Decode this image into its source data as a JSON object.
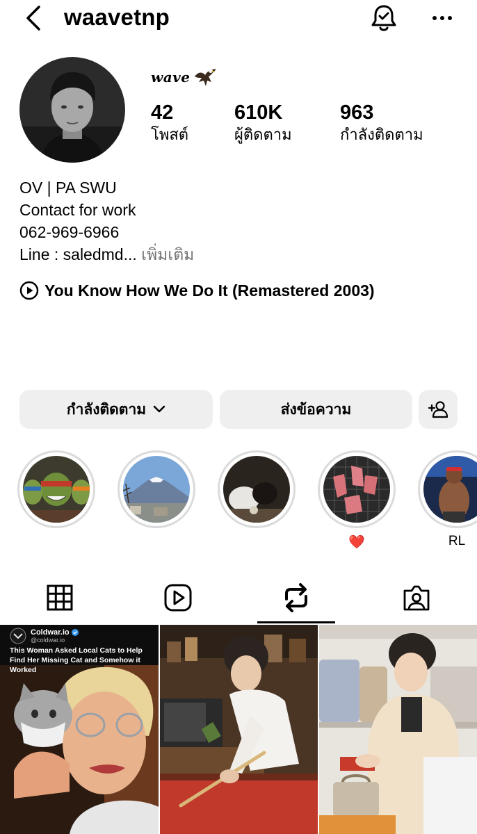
{
  "header": {
    "username": "waavetnp",
    "icons": {
      "back": "chevron-left-icon",
      "notifications": "bell-check-icon",
      "more": "more-horizontal-icon"
    }
  },
  "profile": {
    "display_name": "wave",
    "display_name_emoji": "eagle",
    "stats": [
      {
        "value": "42",
        "label": "โพสต์"
      },
      {
        "value": "610K",
        "label": "ผู้ติดตาม"
      },
      {
        "value": "963",
        "label": "กำลังติดตาม"
      }
    ],
    "bio_lines": [
      "OV | PA SWU",
      "Contact for work",
      "062-969-6966",
      "Line : saledmd..."
    ],
    "bio_more": " เพิ่มเติม",
    "music": "You Know How We Do It (Remastered 2003)"
  },
  "actions": {
    "following_label": "กำลังติดตาม",
    "message_label": "ส่งข้อความ"
  },
  "highlights": [
    {
      "label": ""
    },
    {
      "label": ""
    },
    {
      "label": ""
    },
    {
      "label": "❤️"
    },
    {
      "label": "RL"
    }
  ],
  "tabs": [
    "grid",
    "reels",
    "reposts",
    "tagged"
  ],
  "active_tab": "reposts",
  "grid_posts": [
    {
      "source_name": "Coldwar.io",
      "source_handle": "@coldwar.io",
      "headline": "This Woman Asked Local Cats to Help Find Her Missing Cat and Somehow it Worked"
    },
    {
      "description": "photo"
    },
    {
      "description": "photo"
    }
  ],
  "colors": {
    "button_bg": "#efefef",
    "muted_text": "#737373",
    "highlight_ring": "#dbdbdb",
    "verified": "#3897f0"
  }
}
